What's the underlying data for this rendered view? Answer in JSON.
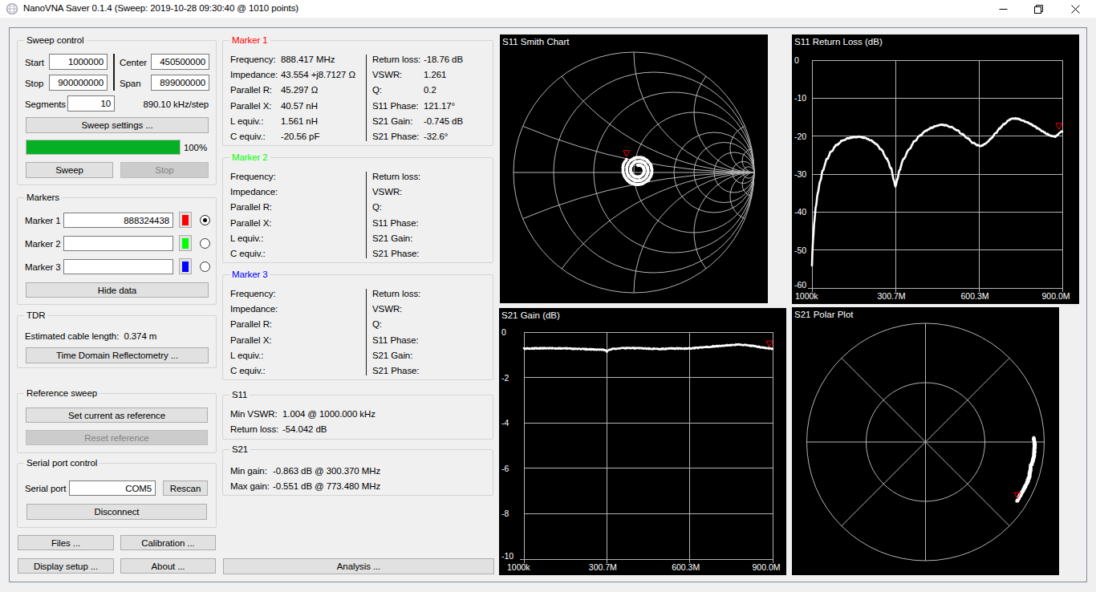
{
  "window": {
    "title": "NanoVNA Saver 0.1.4 (Sweep: 2019-10-28 09:30:40 @ 1010 points)"
  },
  "sweep": {
    "group_title": "Sweep control",
    "start_label": "Start",
    "start_value": "1000000",
    "stop_label": "Stop",
    "stop_value": "900000000",
    "center_label": "Center",
    "center_value": "450500000",
    "span_label": "Span",
    "span_value": "899000000",
    "segments_label": "Segments",
    "segments_value": "10",
    "step_text": "890.10 kHz/step",
    "sweep_settings_button": "Sweep settings ...",
    "progress_percent": 100,
    "progress_text": "100%",
    "progress_color": "#06b025",
    "sweep_button": "Sweep",
    "stop_button": "Stop"
  },
  "markers": {
    "group_title": "Markers",
    "rows": [
      {
        "label": "Marker 1",
        "value": "888324438",
        "color": "#ff0000",
        "selected": true
      },
      {
        "label": "Marker 2",
        "value": "",
        "color": "#00ff00",
        "selected": false
      },
      {
        "label": "Marker 3",
        "value": "",
        "color": "#0000ff",
        "selected": false
      }
    ],
    "hide_data_button": "Hide data"
  },
  "tdr": {
    "group_title": "TDR",
    "cable_length_text": "Estimated cable length:  0.374 m",
    "tdr_button": "Time Domain Reflectometry ..."
  },
  "reference": {
    "group_title": "Reference sweep",
    "set_button": "Set current as reference",
    "reset_button": "Reset reference"
  },
  "serial": {
    "group_title": "Serial port control",
    "port_label": "Serial port",
    "port_value": "COM5",
    "rescan_button": "Rescan",
    "disconnect_button": "Disconnect"
  },
  "footer": {
    "files_button": "Files ...",
    "calibration_button": "Calibration ...",
    "display_setup_button": "Display setup ...",
    "about_button": "About ...",
    "analysis_button": "Analysis ..."
  },
  "marker_data": [
    {
      "title": "Marker 1",
      "color": "#ff0000",
      "left_labels": [
        "Frequency:",
        "Impedance:",
        "Parallel R:",
        "Parallel X:",
        "L equiv.:",
        "C equiv.:"
      ],
      "left_values": [
        "888.417 MHz",
        "43.554 +j8.7127 Ω",
        "45.297 Ω",
        "40.57 nH",
        "1.561 nH",
        "-20.56 pF"
      ],
      "right_labels": [
        "Return loss:",
        "VSWR:",
        "Q:",
        "S11 Phase:",
        "S21 Gain:",
        "S21 Phase:"
      ],
      "right_values": [
        "-18.76 dB",
        "1.261",
        "0.2",
        "121.17°",
        "-0.745 dB",
        "-32.6°"
      ]
    },
    {
      "title": "Marker 2",
      "color": "#00ff00",
      "left_labels": [
        "Frequency:",
        "Impedance:",
        "Parallel R:",
        "Parallel X:",
        "L equiv.:",
        "C equiv.:"
      ],
      "left_values": [
        "",
        "",
        "",
        "",
        "",
        ""
      ],
      "right_labels": [
        "Return loss:",
        "VSWR:",
        "Q:",
        "S11 Phase:",
        "S21 Gain:",
        "S21 Phase:"
      ],
      "right_values": [
        "",
        "",
        "",
        "",
        "",
        ""
      ]
    },
    {
      "title": "Marker 3",
      "color": "#0000ff",
      "left_labels": [
        "Frequency:",
        "Impedance:",
        "Parallel R:",
        "Parallel X:",
        "L equiv.:",
        "C equiv.:"
      ],
      "left_values": [
        "",
        "",
        "",
        "",
        "",
        ""
      ],
      "right_labels": [
        "Return loss:",
        "VSWR:",
        "Q:",
        "S11 Phase:",
        "S21 Gain:",
        "S21 Phase:"
      ],
      "right_values": [
        "",
        "",
        "",
        "",
        "",
        ""
      ]
    }
  ],
  "s11_info": {
    "group_title": "S11",
    "row1_label": "Min VSWR:",
    "row1_value": "1.004 @ 1000.000 kHz",
    "row2_label": "Return loss:",
    "row2_value": "-54.042 dB"
  },
  "s21_info": {
    "group_title": "S21",
    "row1_label": "Min gain:",
    "row1_value": "-0.863 dB @ 300.370 MHz",
    "row2_label": "Max gain:",
    "row2_value": "-0.551 dB @ 773.480 MHz"
  },
  "chart_data": [
    {
      "id": "smith",
      "type": "scatter",
      "title": "S11 Smith Chart",
      "grid_color": "#b4b4b4",
      "data_color": "#ffffff",
      "marker_color": "#ff0000",
      "resistance_circles": [
        0.2,
        0.5,
        1,
        2,
        3,
        5,
        10,
        20
      ],
      "reactance_arcs": [
        0.2,
        0.5,
        1,
        2,
        5,
        10
      ],
      "spiral": {
        "start_mag": 0.04,
        "end_mag": 0.132,
        "end_phase_deg": 138,
        "turns": 2.9,
        "center_offset": [
          0.037,
          0.02
        ]
      },
      "marker": {
        "freq_mhz": 888.324438,
        "mag": 0.115,
        "phase_deg": 121.17
      }
    },
    {
      "id": "returnloss",
      "type": "line",
      "title": "S11 Return Loss (dB)",
      "xlabel": "",
      "ylabel": "dB",
      "xlim": [
        1,
        900
      ],
      "ylim": [
        0,
        -60
      ],
      "x_tick_labels": [
        "1000k",
        "300.7M",
        "600.3M",
        "900.0M"
      ],
      "y_tick_labels": [
        "0",
        "-10",
        "-20",
        "-30",
        "-40",
        "-50",
        "-60"
      ],
      "grid_color": "#b4b4b4",
      "data_color": "#ffffff",
      "marker_color": "#ff0000",
      "marker": {
        "x": 888.324438,
        "y": -18.76
      },
      "points": [
        [
          1,
          -54.0
        ],
        [
          3,
          -50
        ],
        [
          6,
          -46
        ],
        [
          10,
          -42
        ],
        [
          15,
          -38.5
        ],
        [
          22,
          -35
        ],
        [
          30,
          -32
        ],
        [
          40,
          -29
        ],
        [
          55,
          -26
        ],
        [
          70,
          -24
        ],
        [
          90,
          -22.3
        ],
        [
          110,
          -21.2
        ],
        [
          130,
          -20.6
        ],
        [
          150,
          -20.3
        ],
        [
          170,
          -20.2
        ],
        [
          190,
          -20.4
        ],
        [
          210,
          -21.0
        ],
        [
          230,
          -22.0
        ],
        [
          250,
          -23.6
        ],
        [
          270,
          -26
        ],
        [
          285,
          -28.5
        ],
        [
          295,
          -31.5
        ],
        [
          300.7,
          -33.3
        ],
        [
          307,
          -31.5
        ],
        [
          315,
          -29
        ],
        [
          330,
          -26
        ],
        [
          350,
          -23.4
        ],
        [
          370,
          -21.3
        ],
        [
          390,
          -19.8
        ],
        [
          410,
          -18.6
        ],
        [
          430,
          -17.8
        ],
        [
          450,
          -17.2
        ],
        [
          465,
          -17.0
        ],
        [
          480,
          -17.1
        ],
        [
          500,
          -17.6
        ],
        [
          520,
          -18.4
        ],
        [
          540,
          -19.4
        ],
        [
          560,
          -20.6
        ],
        [
          580,
          -21.8
        ],
        [
          595,
          -22.4
        ],
        [
          605,
          -22.6
        ],
        [
          615,
          -22.4
        ],
        [
          630,
          -21.7
        ],
        [
          645,
          -20.6
        ],
        [
          660,
          -19.3
        ],
        [
          675,
          -18.0
        ],
        [
          690,
          -16.9
        ],
        [
          705,
          -16.0
        ],
        [
          715,
          -15.5
        ],
        [
          725,
          -15.3
        ],
        [
          740,
          -15.4
        ],
        [
          755,
          -15.8
        ],
        [
          770,
          -16.2
        ],
        [
          785,
          -16.8
        ],
        [
          800,
          -17.4
        ],
        [
          815,
          -18.1
        ],
        [
          830,
          -18.8
        ],
        [
          845,
          -19.4
        ],
        [
          855,
          -19.8
        ],
        [
          865,
          -20.0
        ],
        [
          875,
          -20.1
        ],
        [
          880,
          -19.9
        ],
        [
          885,
          -19.5
        ],
        [
          890,
          -19.1
        ],
        [
          895,
          -18.9
        ],
        [
          900,
          -18.76
        ]
      ]
    },
    {
      "id": "gain",
      "type": "line",
      "title": "S21 Gain (dB)",
      "xlabel": "",
      "ylabel": "dB",
      "xlim": [
        1,
        900
      ],
      "ylim": [
        0,
        -10
      ],
      "x_tick_labels": [
        "1000k",
        "300.7M",
        "600.3M",
        "900.0M"
      ],
      "y_tick_labels": [
        "0",
        "-2",
        "-4",
        "-6",
        "-8",
        "-10"
      ],
      "grid_color": "#b4b4b4",
      "data_color": "#ffffff",
      "marker_color": "#ff0000",
      "marker": {
        "x": 888.324438,
        "y": -0.745
      },
      "points": [
        [
          1,
          -0.73
        ],
        [
          30,
          -0.72
        ],
        [
          60,
          -0.71
        ],
        [
          100,
          -0.71
        ],
        [
          150,
          -0.72
        ],
        [
          200,
          -0.74
        ],
        [
          250,
          -0.76
        ],
        [
          290,
          -0.78
        ],
        [
          297,
          -0.81
        ],
        [
          300.37,
          -0.863
        ],
        [
          304,
          -0.8
        ],
        [
          312,
          -0.76
        ],
        [
          340,
          -0.72
        ],
        [
          380,
          -0.7
        ],
        [
          420,
          -0.71
        ],
        [
          460,
          -0.73
        ],
        [
          500,
          -0.74
        ],
        [
          540,
          -0.72
        ],
        [
          580,
          -0.73
        ],
        [
          620,
          -0.7
        ],
        [
          660,
          -0.66
        ],
        [
          700,
          -0.62
        ],
        [
          740,
          -0.58
        ],
        [
          773.48,
          -0.551
        ],
        [
          800,
          -0.57
        ],
        [
          820,
          -0.6
        ],
        [
          840,
          -0.63
        ],
        [
          860,
          -0.67
        ],
        [
          880,
          -0.7
        ],
        [
          890,
          -0.72
        ],
        [
          900,
          -0.745
        ]
      ]
    },
    {
      "id": "polar",
      "type": "scatter",
      "title": "S21 Polar Plot",
      "grid_color": "#b4b4b4",
      "data_color": "#ffffff",
      "marker_color": "#ff0000",
      "points_polar": [
        [
          2.0,
          0.912
        ],
        [
          0.5,
          0.917
        ],
        [
          -1.5,
          0.919
        ],
        [
          -4,
          0.92
        ],
        [
          -7,
          0.921
        ],
        [
          -10,
          0.918
        ],
        [
          -13,
          0.91
        ],
        [
          -16,
          0.916
        ],
        [
          -19,
          0.922
        ],
        [
          -22,
          0.921
        ],
        [
          -25,
          0.919
        ],
        [
          -28,
          0.916
        ],
        [
          -30.5,
          0.915
        ],
        [
          -32.6,
          0.918
        ]
      ],
      "marker": {
        "phase_deg": -32.6,
        "mag": 0.918
      }
    }
  ]
}
